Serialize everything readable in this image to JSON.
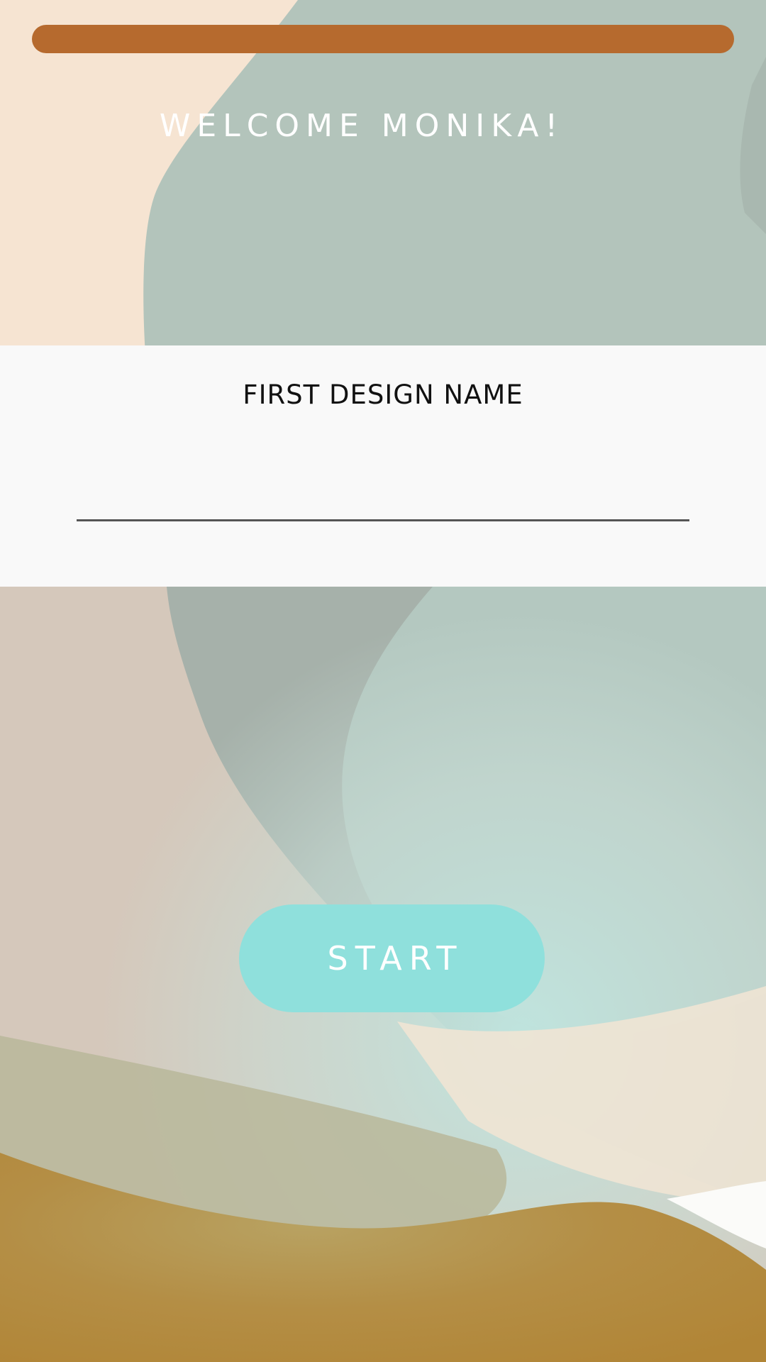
{
  "header": {
    "welcome_text": "WELCOME MONIKA!",
    "progress_bar_color": "#b66a2e"
  },
  "form": {
    "field_label": "FIRST DESIGN NAME",
    "name_value": "",
    "name_placeholder": ""
  },
  "actions": {
    "start_label": "START",
    "start_color": "#8fe0dc"
  },
  "background": {
    "colors": {
      "peach": "#f6e4d2",
      "sage": "#b3c4bb",
      "mint": "#bde0da",
      "mustard": "#b28838"
    }
  }
}
